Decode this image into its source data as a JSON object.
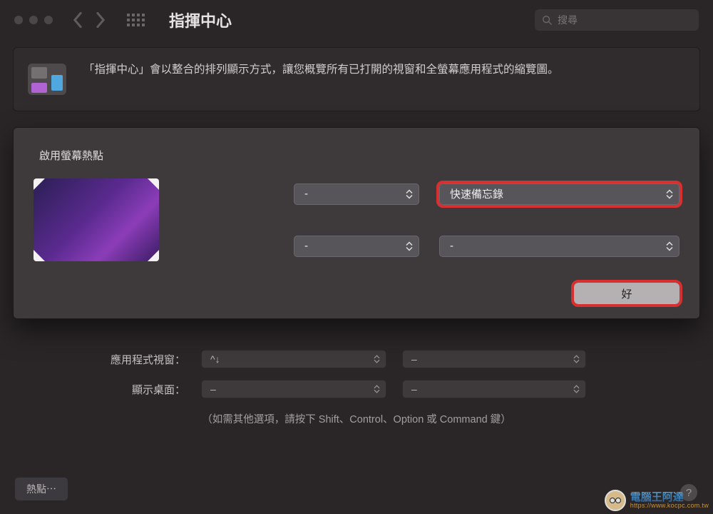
{
  "toolbar": {
    "title": "指揮中心",
    "search_placeholder": "搜尋"
  },
  "description": "「指揮中心」會以整合的排列顯示方式，讓您概覽所有已打開的視窗和全螢幕應用程式的縮覽圖。",
  "sheet": {
    "title": "啟用螢幕熱點",
    "corners": {
      "top_left": "-",
      "top_right": "快速備忘錄",
      "bottom_left": "-",
      "bottom_right": "-"
    },
    "ok_label": "好"
  },
  "bg": {
    "row1_label": "應用程式視窗：",
    "row1_value": "^↓",
    "row1_right": "–",
    "row2_label": "顯示桌面：",
    "row2_value": "–",
    "row2_right": "–",
    "hint": "（如需其他選項，請按下 Shift、Control、Option 或 Command 鍵）",
    "hotcorners_btn": "熱點⋯"
  },
  "watermark": {
    "name": "電腦王阿達",
    "url": "https://www.kocpc.com.tw"
  }
}
